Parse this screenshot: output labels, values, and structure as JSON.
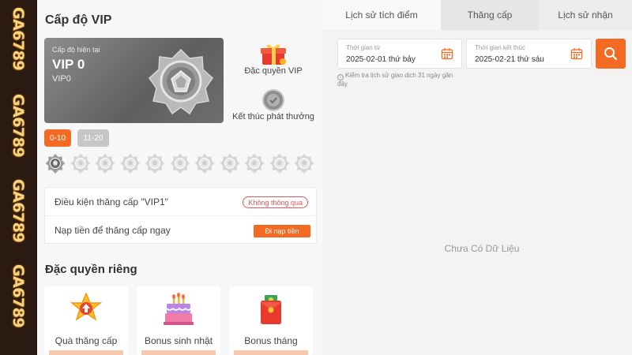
{
  "strip": {
    "logo_text": "GA6789"
  },
  "vip": {
    "title": "Cấp độ VIP",
    "current_label": "Cấp độ hiện tại",
    "level": "VIP 0",
    "level_sub": "VIP0",
    "privilege_label": "Đặc quyền VIP",
    "end_label": "Kết thúc phát thưởng",
    "ranges": [
      "0-10",
      "11-20"
    ],
    "condition_label": "Điều kiện thăng cấp \"VIP1\"",
    "condition_status": "Không thông qua",
    "deposit_label": "Nạp tiền để thăng cấp ngay",
    "deposit_button": "Đi nạp tiền"
  },
  "perks": {
    "title": "Đặc quyền riêng",
    "items": [
      {
        "label": "Quà thăng cấp",
        "icon": "star-arrow-icon"
      },
      {
        "label": "Bonus sinh nhật",
        "icon": "birthday-cake-icon"
      },
      {
        "label": "Bonus tháng",
        "icon": "red-envelope-icon"
      }
    ]
  },
  "history": {
    "tabs": [
      "Lịch sử tích điểm",
      "Thăng cấp",
      "Lịch sử nhận"
    ],
    "start_label": "Thời gian từ",
    "start_value": "2025-02-01 thứ bảy",
    "end_label": "Thời gian kết thúc",
    "end_value": "2025-02-21 thứ sáu",
    "hint": "Kiểm tra lịch sử giao dịch 31 ngày gần đây",
    "empty": "Chưa Có Dữ Liệu"
  },
  "colors": {
    "accent": "#f36b22",
    "strip": "#2a1a12",
    "gold": "#f7d382"
  }
}
